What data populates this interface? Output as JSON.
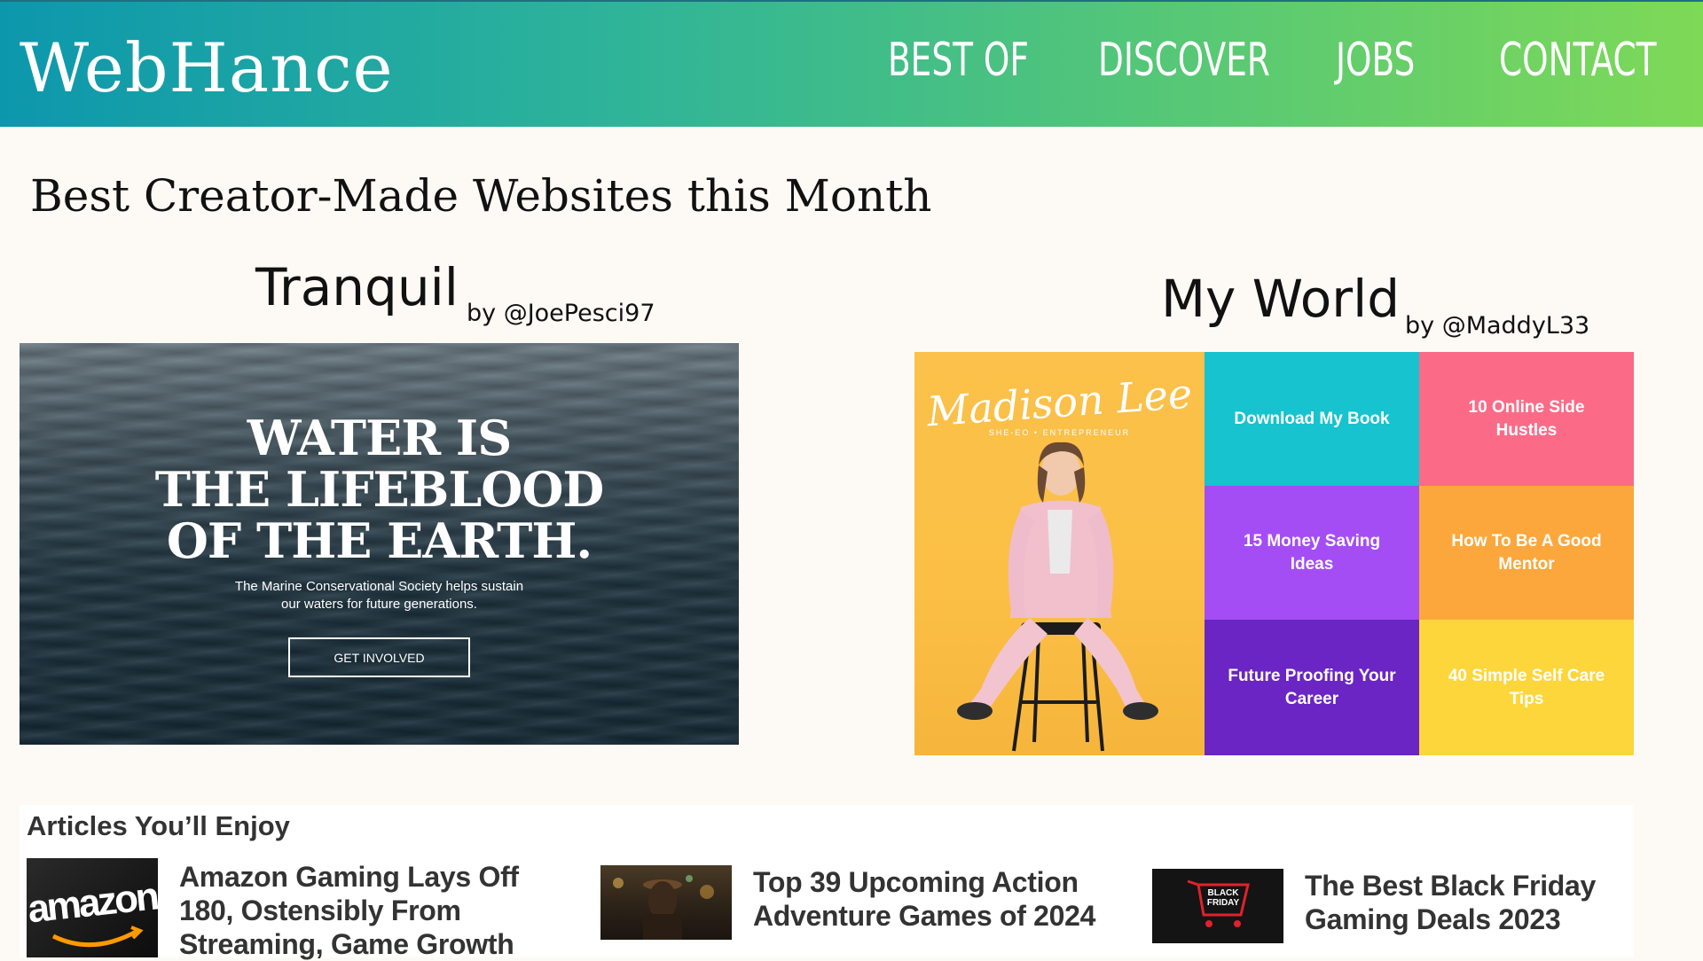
{
  "header": {
    "logo": "WebHance",
    "nav": [
      "BEST OF",
      "DISCOVER",
      "JOBS",
      "CONTACT"
    ]
  },
  "page_title": "Best Creator-Made Websites this Month",
  "showcases": [
    {
      "name": "Tranquil",
      "author": "by @JoePesci97",
      "preview": {
        "headline": [
          "WATER IS",
          "THE LIFEBLOOD",
          "OF THE EARTH."
        ],
        "subtext": [
          "The Marine Conservational Society helps sustain",
          "our waters for future generations."
        ],
        "button": "GET INVOLVED"
      }
    },
    {
      "name": "My World",
      "author": "by @MaddyL33",
      "preview": {
        "signature": "Madison Lee",
        "tagline": "SHE-EO  •  ENTREPRENEUR",
        "tiles": [
          {
            "label": "Download My Book",
            "color": "#16c3cf"
          },
          {
            "label": "10 Online Side Hustles",
            "color": "#fb6b87"
          },
          {
            "label": "15 Money Saving Ideas",
            "color": "#a44df4"
          },
          {
            "label": "How To Be A Good Mentor",
            "color": "#fca73b"
          },
          {
            "label": "Future Proofing Your Career",
            "color": "#6a25c4"
          },
          {
            "label": "40 Simple Self Care Tips",
            "color": "#fdd63b"
          }
        ]
      }
    }
  ],
  "articles": {
    "title": "Articles You’ll Enjoy",
    "items": [
      {
        "title": "Amazon Gaming Lays Off 180, Ostensibly From Streaming, Game Growth",
        "thumb_text": "amazon"
      },
      {
        "title": "Top 39 Upcoming Action Adventure Games of 2024",
        "thumb_text": ""
      },
      {
        "title": "The Best Black Friday Gaming Deals 2023",
        "thumb_text": "BLACK FRIDAY"
      }
    ]
  }
}
